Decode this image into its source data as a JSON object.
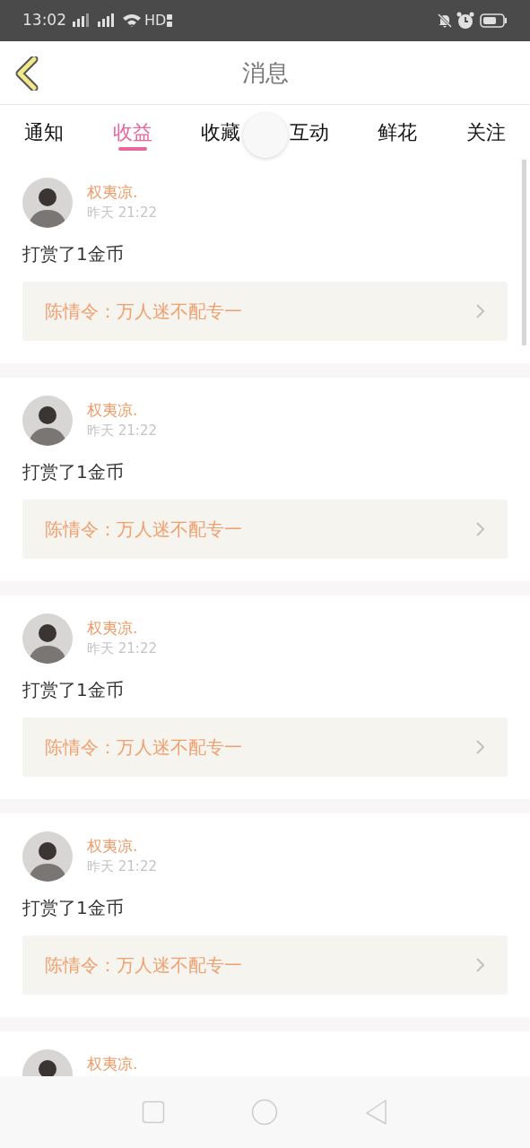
{
  "status_bar": {
    "time": "13:02",
    "network": "HD"
  },
  "header": {
    "title": "消息"
  },
  "tabs": [
    {
      "label": "通知",
      "selected": false
    },
    {
      "label": "收益",
      "selected": true
    },
    {
      "label": "收藏",
      "selected": false
    },
    {
      "label": "互动",
      "selected": false
    },
    {
      "label": "鲜花",
      "selected": false
    },
    {
      "label": "关注",
      "selected": false
    }
  ],
  "messages": [
    {
      "name": "权夷凉.",
      "time": "昨天 21:22",
      "text": "打赏了1金币",
      "link": "陈情令：万人迷不配专一"
    },
    {
      "name": "权夷凉.",
      "time": "昨天 21:22",
      "text": "打赏了1金币",
      "link": "陈情令：万人迷不配专一"
    },
    {
      "name": "权夷凉.",
      "time": "昨天 21:22",
      "text": "打赏了1金币",
      "link": "陈情令：万人迷不配专一"
    },
    {
      "name": "权夷凉.",
      "time": "昨天 21:22",
      "text": "打赏了1金币",
      "link": "陈情令：万人迷不配专一"
    },
    {
      "name": "权夷凉."
    }
  ]
}
